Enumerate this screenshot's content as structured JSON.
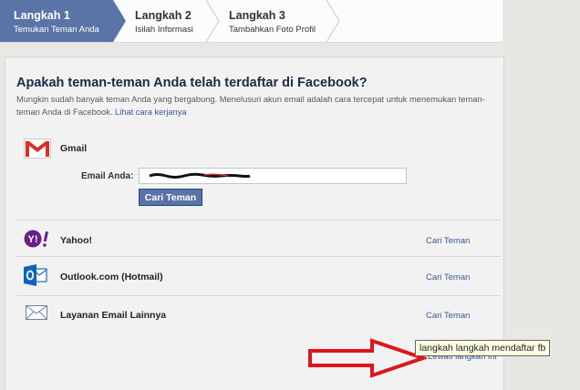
{
  "steps": [
    {
      "title": "Langkah 1",
      "subtitle": "Temukan Teman Anda"
    },
    {
      "title": "Langkah 2",
      "subtitle": "Isilah Informasi"
    },
    {
      "title": "Langkah 3",
      "subtitle": "Tambahkan Foto Profil"
    }
  ],
  "main": {
    "heading": "Apakah teman-teman Anda telah terdaftar di Facebook?",
    "description": "Mungkin sudah banyak teman Anda yang bergabung. Menelusuri akun email adalah cara tercepat untuk menemukan teman-teman Anda di Facebook.",
    "how_link": "Lihat cara kerjanya"
  },
  "gmail": {
    "name": "Gmail",
    "email_label": "Email Anda:",
    "email_value": "",
    "button": "Cari Teman"
  },
  "providers": [
    {
      "name": "Yahoo!",
      "action": "Cari Teman"
    },
    {
      "name": "Outlook.com (Hotmail)",
      "action": "Cari Teman"
    },
    {
      "name": "Layanan Email Lainnya",
      "action": "Cari Teman"
    }
  ],
  "skip_link": "Lewati langkah ini",
  "tooltip": "langkah langkah mendaftar fb",
  "colors": {
    "accent": "#3b5998",
    "step_active": "#5b74a8",
    "annotation": "#e0141b"
  },
  "icons": [
    "gmail-icon",
    "yahoo-icon",
    "outlook-icon",
    "envelope-icon",
    "red-arrow"
  ]
}
